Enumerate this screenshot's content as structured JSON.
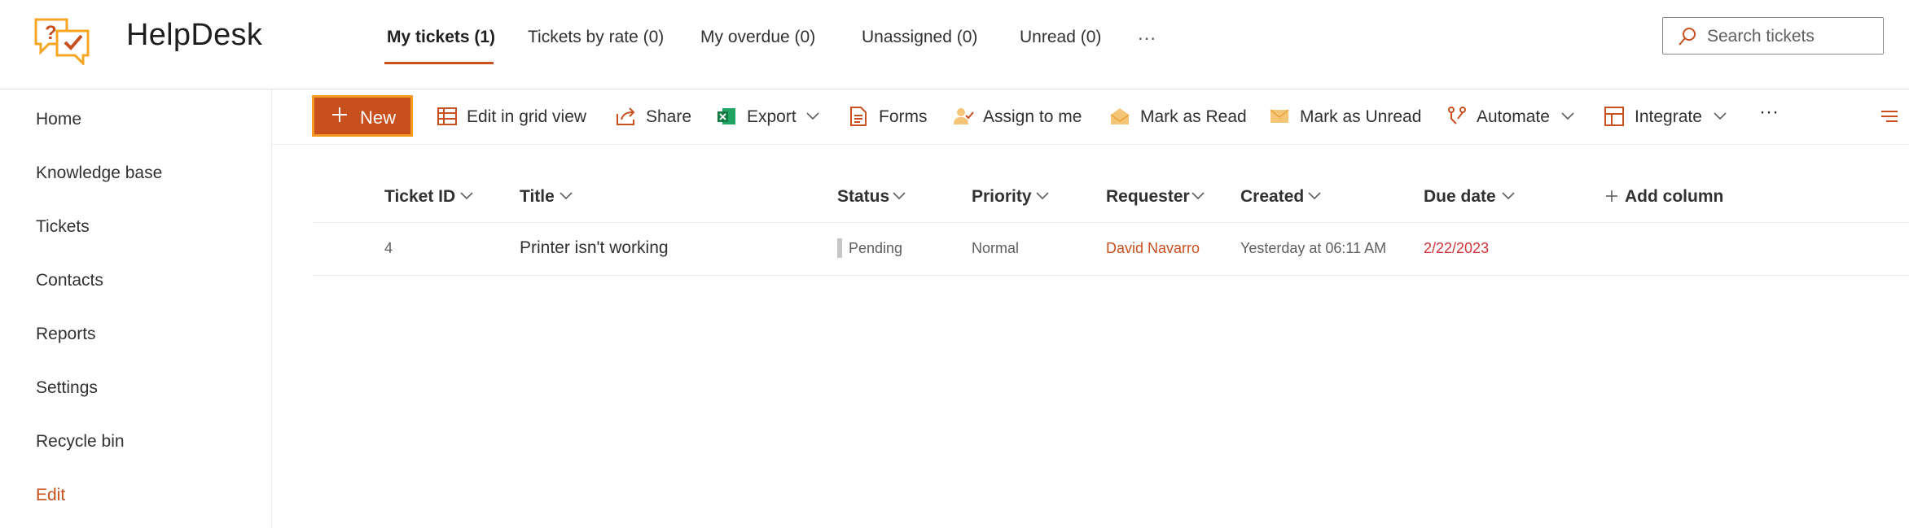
{
  "app": {
    "title": "HelpDesk",
    "logo_icon": "helpdesk-chat-check-icon",
    "brand_color": "#c8501e"
  },
  "tabs": [
    {
      "label": "My tickets (1)",
      "active": true
    },
    {
      "label": "Tickets by rate (0)",
      "active": false
    },
    {
      "label": "My overdue (0)",
      "active": false
    },
    {
      "label": "Unassigned (0)",
      "active": false
    },
    {
      "label": "Unread (0)",
      "active": false
    }
  ],
  "tabs_more": "…",
  "search": {
    "placeholder": "Search tickets",
    "icon": "search-icon"
  },
  "sidebar": {
    "items": [
      {
        "label": "Home"
      },
      {
        "label": "Knowledge base"
      },
      {
        "label": "Tickets"
      },
      {
        "label": "Contacts"
      },
      {
        "label": "Reports"
      },
      {
        "label": "Settings"
      },
      {
        "label": "Recycle bin"
      },
      {
        "label": "Edit"
      }
    ]
  },
  "commands": {
    "new": "New",
    "edit_grid": "Edit in grid view",
    "share": "Share",
    "export": "Export",
    "forms": "Forms",
    "assign": "Assign to me",
    "mark_read": "Mark as Read",
    "mark_unread": "Mark as Unread",
    "automate": "Automate",
    "integrate": "Integrate",
    "more": "···"
  },
  "table": {
    "columns": {
      "ticket_id": "Ticket ID",
      "title": "Title",
      "status": "Status",
      "priority": "Priority",
      "requester": "Requester",
      "created": "Created",
      "due_date": "Due date",
      "add_column": "Add column"
    },
    "rows": [
      {
        "ticket_id": "4",
        "title": "Printer isn't working",
        "status": "Pending",
        "priority": "Normal",
        "requester": "David Navarro",
        "created": "Yesterday at 06:11 AM",
        "due_date": "2/22/2023"
      }
    ]
  }
}
